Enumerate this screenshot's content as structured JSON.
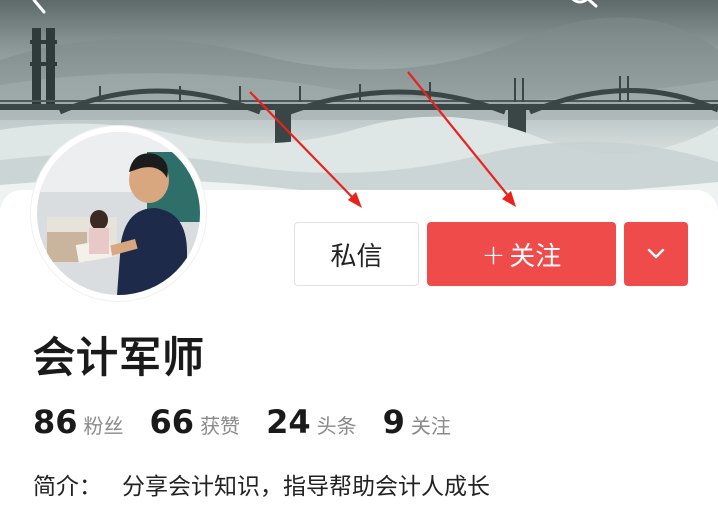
{
  "header": {
    "back_icon": "chevron-left-icon",
    "search_icon": "search-icon"
  },
  "profile": {
    "name": "会计军师",
    "stats": [
      {
        "count": "86",
        "label": "粉丝"
      },
      {
        "count": "66",
        "label": "获赞"
      },
      {
        "count": "24",
        "label": "头条"
      },
      {
        "count": "9",
        "label": "关注"
      }
    ],
    "bio_label": "简介：",
    "bio_text": "分享会计知识，指导帮助会计人成长"
  },
  "actions": {
    "message_label": "私信",
    "follow_plus": "+",
    "follow_label": "关注",
    "more_icon": "chevron-down-icon"
  },
  "colors": {
    "accent": "#ef4b4b",
    "annotation_arrow": "#e8231c"
  }
}
